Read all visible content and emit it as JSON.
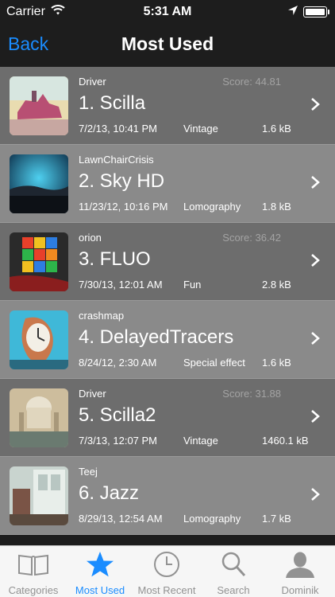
{
  "status": {
    "carrier": "Carrier",
    "time": "5:31 AM"
  },
  "nav": {
    "back": "Back",
    "title": "Most Used"
  },
  "rows": [
    {
      "author": "Driver",
      "score": "Score: 44.81",
      "name": "1. Scilla",
      "date": "7/2/13, 10:41 PM",
      "category": "Vintage",
      "size": "1.6 kB"
    },
    {
      "author": "LawnChairCrisis",
      "score": "",
      "name": "2. Sky HD",
      "date": "11/23/12, 10:16 PM",
      "category": "Lomography",
      "size": "1.8 kB"
    },
    {
      "author": "orion",
      "score": "Score: 36.42",
      "name": "3. FLUO",
      "date": "7/30/13, 12:01 AM",
      "category": "Fun",
      "size": "2.8 kB"
    },
    {
      "author": "crashmap",
      "score": "",
      "name": "4. DelayedTracers",
      "date": "8/24/12, 2:30 AM",
      "category": "Special effect",
      "size": "1.6 kB"
    },
    {
      "author": "Driver",
      "score": "Score: 31.88",
      "name": "5. Scilla2",
      "date": "7/3/13, 12:07 PM",
      "category": "Vintage",
      "size": "1460.1 kB"
    },
    {
      "author": "Teej",
      "score": "",
      "name": "6. Jazz",
      "date": "8/29/13, 12:54 AM",
      "category": "Lomography",
      "size": "1.7 kB"
    }
  ],
  "tabs": [
    {
      "label": "Categories",
      "icon": "book-icon"
    },
    {
      "label": "Most Used",
      "icon": "star-icon"
    },
    {
      "label": "Most Recent",
      "icon": "clock-icon"
    },
    {
      "label": "Search",
      "icon": "search-icon"
    },
    {
      "label": "Dominik",
      "icon": "person-icon"
    }
  ],
  "colors": {
    "accent": "#1a8cff",
    "row_dark": "#6d6d6d",
    "row_light": "#8a8a8a",
    "tab_inactive": "#929292"
  }
}
